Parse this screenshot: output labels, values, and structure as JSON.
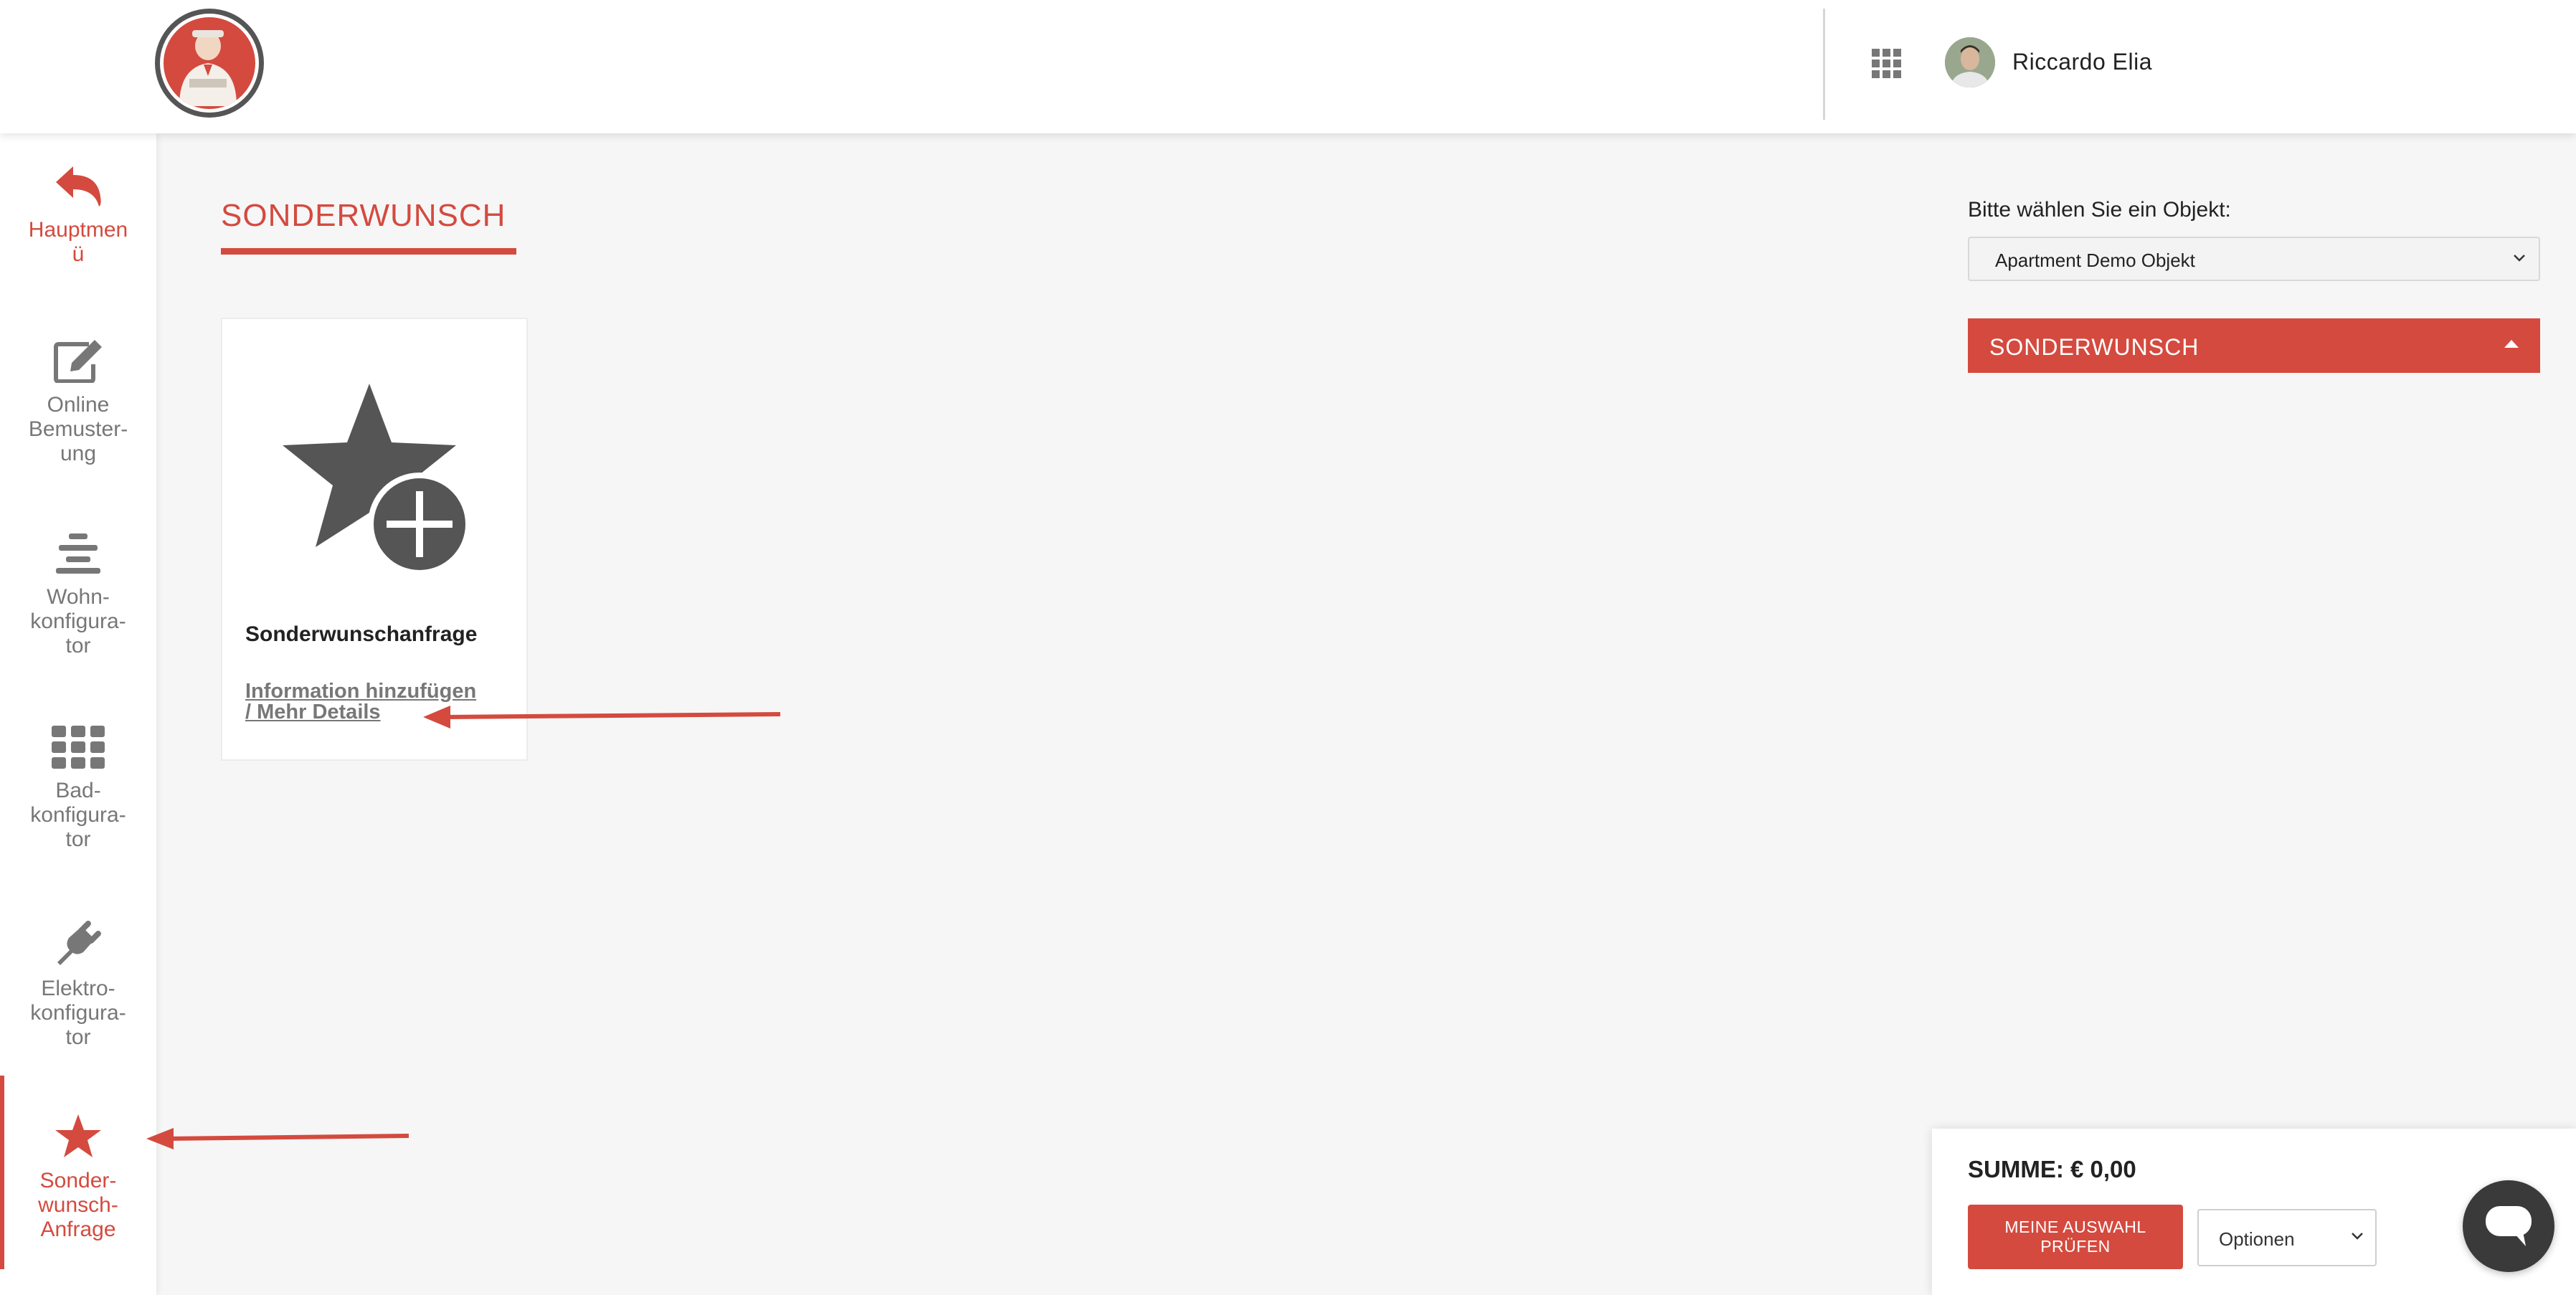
{
  "header": {
    "user_name": "Riccardo Elia",
    "logo_icon": "craftsman-logo",
    "apps_icon": "grid-apps-icon"
  },
  "sidebar": {
    "items": [
      {
        "label": "Hauptmen\nü",
        "icon": "back-arrow-icon",
        "color": "#d44a3f"
      },
      {
        "label": "Online\nBemuster-\nung",
        "icon": "edit-icon"
      },
      {
        "label": "Wohn-\nkonfigura-\ntor",
        "icon": "layers-icon"
      },
      {
        "label": "Bad-\nkonfigura-\ntor",
        "icon": "grid-icon"
      },
      {
        "label": "Elektro-\nkonfigura-\ntor",
        "icon": "plug-icon"
      },
      {
        "label": "Sonder-\nwunsch-\nAnfrage",
        "icon": "star-icon",
        "color": "#d44a3f",
        "active": true
      }
    ]
  },
  "main": {
    "title": "SONDERWUNSCH",
    "card": {
      "icon": "star-plus-icon",
      "title": "Sonderwunschanfrage",
      "link": "Information hinzufügen\n/ Mehr Details"
    }
  },
  "right_panel": {
    "object_label": "Bitte wählen Sie ein Objekt:",
    "object_selected": "Apartment Demo Objekt",
    "accordion_title": "SONDERWUNSCH"
  },
  "summary": {
    "total": "SUMME: € 0,00",
    "check_button": "MEINE AUSWAHL\nPRÜFEN",
    "options_selected": "Optionen"
  },
  "colors": {
    "accent": "#d44a3f",
    "icon_gray": "#555555",
    "background": "#f6f6f6"
  }
}
